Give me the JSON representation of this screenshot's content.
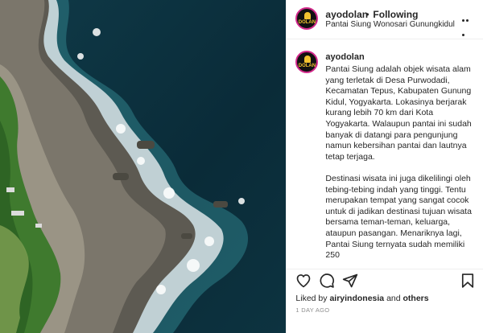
{
  "post": {
    "image_alt": "Aerial photo of rocky coastline with waves",
    "username": "ayodolan",
    "separator": "•",
    "follow_status": "Following",
    "location": "Pantai Siung Wonosari Gunungkidul",
    "avatar_text": "DOLAN",
    "caption": {
      "username": "ayodolan",
      "paragraph_1": "Pantai Siung adalah objek wisata alam yang terletak di Desa Purwodadi, Kecamatan Tepus, Kabupaten Gunung Kidul, Yogyakarta. Lokasinya berjarak kurang lebih 70 km dari Kota Yogyakarta. Walaupun pantai ini sudah banyak di datangi para pengunjung namun kebersihan pantai dan lautnya tetap terjaga.",
      "paragraph_2": "Destinasi wisata ini juga dikelilingi oleh tebing-tebing indah yang tinggi. Tentu merupakan tempat yang sangat cocok untuk di jadikan destinasi tujuan wisata bersama teman-teman, keluarga, ataupun pasangan. Menariknya lagi, Pantai Siung ternyata sudah memiliki 250"
    },
    "likes": {
      "prefix": "Liked by",
      "user": "airyindonesia",
      "connector": "and",
      "others": "others"
    },
    "time": "1 DAY AGO",
    "icons": [
      "heart-icon",
      "comment-icon",
      "share-icon",
      "bookmark-icon",
      "more-icon"
    ],
    "colors": {
      "text": "#262626",
      "muted": "#8e8e8e",
      "avatar_ring": "#d32a8c",
      "sea": "#0d2f3b"
    }
  }
}
